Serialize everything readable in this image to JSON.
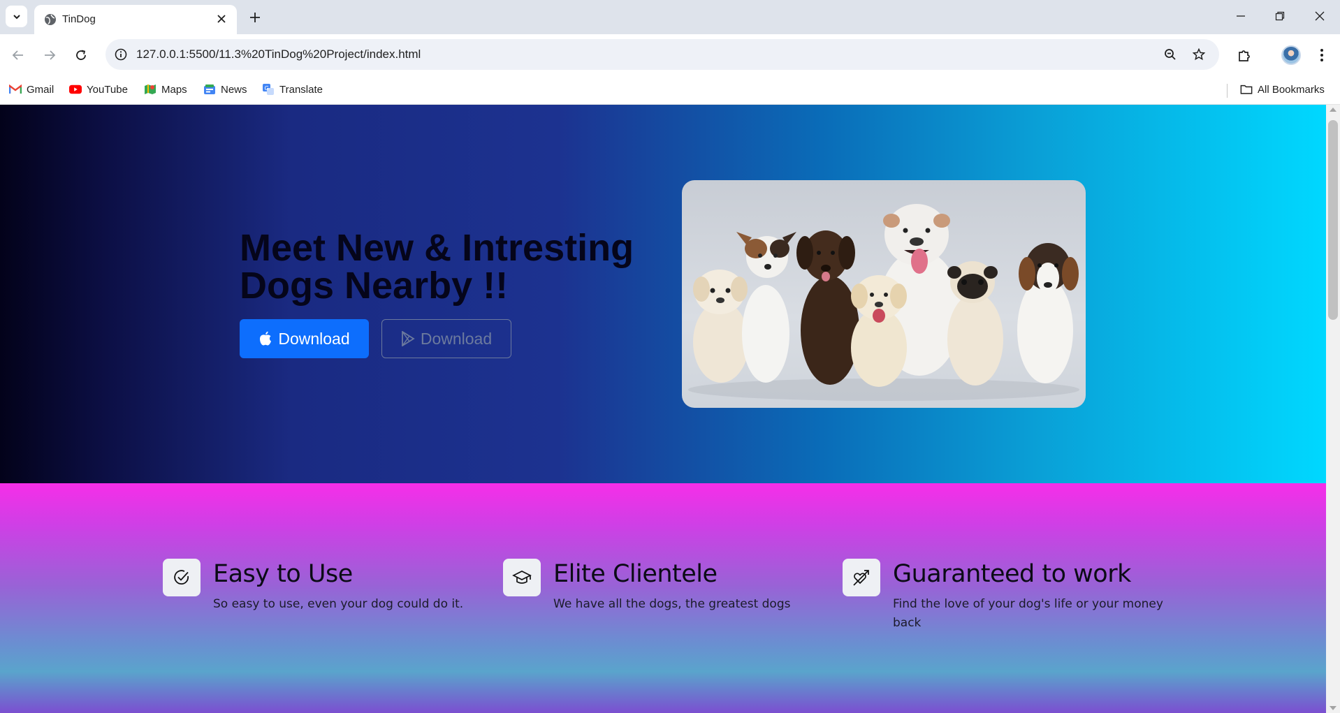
{
  "browser": {
    "tab_title": "TinDog",
    "url": "127.0.0.1:5500/11.3%20TinDog%20Project/index.html",
    "bookmarks": [
      {
        "label": "Gmail",
        "icon": "gmail-icon"
      },
      {
        "label": "YouTube",
        "icon": "youtube-icon"
      },
      {
        "label": "Maps",
        "icon": "maps-icon"
      },
      {
        "label": "News",
        "icon": "news-icon"
      },
      {
        "label": "Translate",
        "icon": "translate-icon"
      }
    ],
    "all_bookmarks_label": "All Bookmarks"
  },
  "hero": {
    "title_line1": "Meet New & Intresting",
    "title_line2": "Dogs Nearby !!",
    "btn_apple_label": "Download",
    "btn_play_label": "Download",
    "image_icon": "dogs-photo"
  },
  "features": [
    {
      "icon": "check-circle-icon",
      "title": "Easy to Use",
      "text": "So easy to use, even your dog could do it."
    },
    {
      "icon": "mortarboard-icon",
      "title": "Elite Clientele",
      "text": "We have all the dogs, the greatest dogs"
    },
    {
      "icon": "heart-arrow-icon",
      "title": "Guaranteed to work",
      "text": "Find the love of your dog's life or your money back"
    }
  ],
  "colors": {
    "primary_button": "#0d6efd",
    "hero_gradient": [
      "#03021a",
      "#1c3290",
      "#00d8ff"
    ],
    "features_gradient": [
      "#f62ee8",
      "#9863d6",
      "#5aa4cc"
    ]
  }
}
